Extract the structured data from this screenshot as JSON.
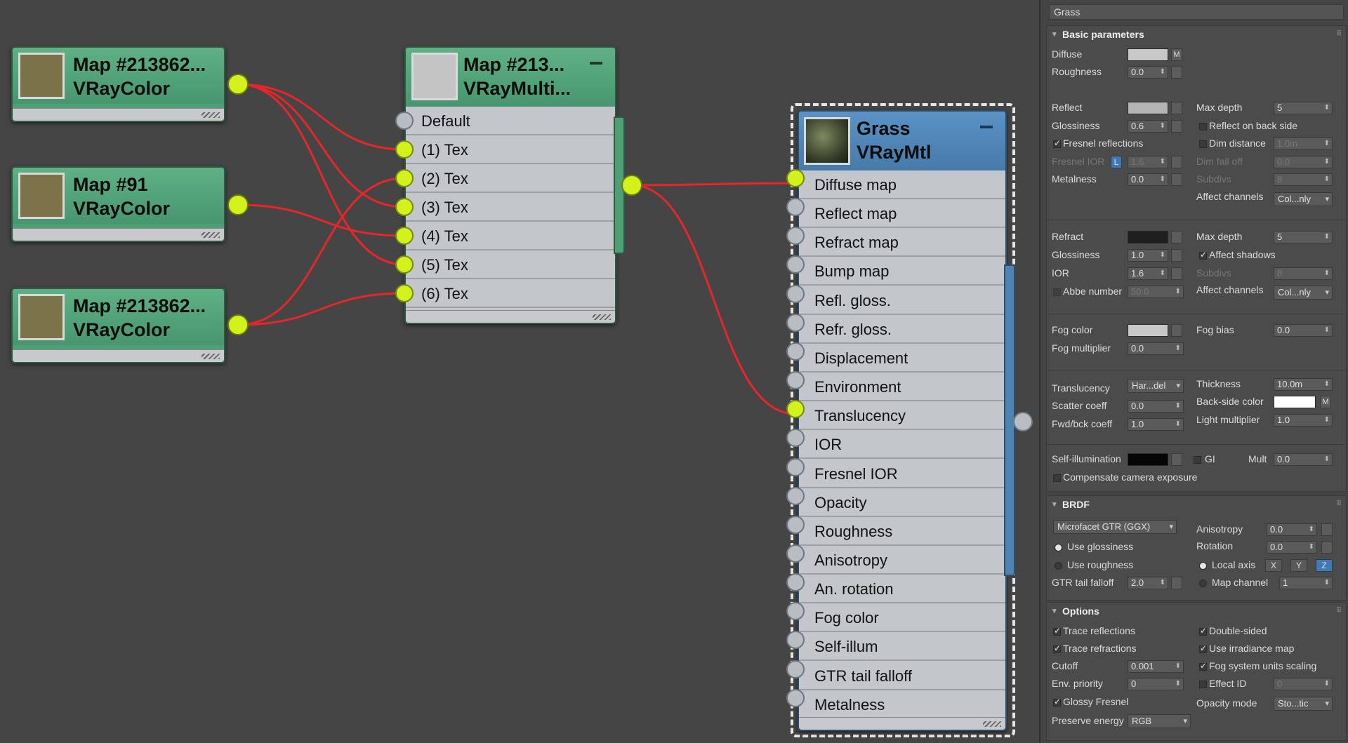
{
  "nodes": {
    "map1": {
      "name": "Map #213862...",
      "type": "VRayColor",
      "thumb_color": "#7b7248"
    },
    "map2": {
      "name": "Map #91",
      "type": "VRayColor",
      "thumb_color": "#7e7348"
    },
    "map3": {
      "name": "Map #213862...",
      "type": "VRayColor",
      "thumb_color": "#7a7448"
    },
    "multi": {
      "name": "Map #213...",
      "type": "VRayMulti...",
      "thumb_color": "#c4c4c4",
      "slots": [
        "Default",
        "(1) Tex",
        "(2) Tex",
        "(3) Tex",
        "(4) Tex",
        "(5) Tex",
        "(6) Tex"
      ]
    },
    "mtl": {
      "name": "Grass",
      "type": "VRayMtl",
      "slots": [
        "Diffuse map",
        "Reflect map",
        "Refract map",
        "Bump map",
        "Refl. gloss.",
        "Refr. gloss.",
        "Displacement",
        "Environment",
        "Translucency",
        "IOR",
        "Fresnel IOR",
        "Opacity",
        "Roughness",
        "Anisotropy",
        "An. rotation",
        "Fog color",
        "Self-illum",
        "GTR tail falloff",
        "Metalness"
      ]
    }
  },
  "colors": {
    "wire": "#e8262a",
    "socket_active": "#d3f11a",
    "green_node": "#4f9f74",
    "blue_node": "#4e83b3"
  },
  "panel": {
    "title": "Grass",
    "basic": {
      "header": "Basic parameters",
      "diffuse": "Diffuse",
      "m": "M",
      "roughness": "Roughness",
      "roughness_val": "0.0",
      "reflect": "Reflect",
      "max_depth": "Max depth",
      "max_depth_val": "5",
      "glossiness": "Glossiness",
      "gloss_val": "0.6",
      "reflect_back": "Reflect on back side",
      "fresnel": "Fresnel reflections",
      "dim_distance": "Dim distance",
      "dim_distance_val": "1.0m",
      "fresnel_ior": "Fresnel IOR",
      "l": "L",
      "fresnel_ior_val": "1.6",
      "dim_falloff": "Dim fall off",
      "dim_falloff_val": "0.0",
      "metalness": "Metalness",
      "metalness_val": "0.0",
      "subdivs": "Subdivs",
      "subdivs_val": "8",
      "affect_channels": "Affect channels",
      "affect_channels_val": "Col...nly",
      "refract": "Refract",
      "refr_max_depth_val": "5",
      "refr_gloss_val": "1.0",
      "affect_shadows": "Affect shadows",
      "ior": "IOR",
      "ior_val": "1.6",
      "refr_subdivs_val": "8",
      "abbe": "Abbe number",
      "abbe_val": "50.0",
      "fog_color": "Fog color",
      "fog_bias": "Fog bias",
      "fog_bias_val": "0.0",
      "fog_mult": "Fog multiplier",
      "fog_mult_val": "0.0",
      "translucency": "Translucency",
      "translucency_val": "Har...del",
      "thickness": "Thickness",
      "thickness_val": "10.0m",
      "scatter": "Scatter coeff",
      "scatter_val": "0.0",
      "backside": "Back-side color",
      "fwd": "Fwd/bck coeff",
      "fwd_val": "1.0",
      "light_mult": "Light multiplier",
      "light_mult_val": "1.0",
      "selfillum": "Self-illumination",
      "gi": "GI",
      "mult": "Mult",
      "mult_val": "0.0",
      "compensate": "Compensate camera exposure"
    },
    "brdf": {
      "header": "BRDF",
      "type": "Microfacet GTR (GGX)",
      "anisotropy": "Anisotropy",
      "anisotropy_val": "0.0",
      "use_gloss": "Use glossiness",
      "rotation": "Rotation",
      "rotation_val": "0.0",
      "use_rough": "Use roughness",
      "local_axis": "Local axis",
      "x": "X",
      "y": "Y",
      "z": "Z",
      "gtr": "GTR tail falloff",
      "gtr_val": "2.0",
      "map_channel": "Map channel",
      "map_channel_val": "1"
    },
    "options": {
      "header": "Options",
      "trace_refl": "Trace reflections",
      "double_sided": "Double-sided",
      "trace_refr": "Trace refractions",
      "use_irr": "Use irradiance map",
      "cutoff": "Cutoff",
      "cutoff_val": "0.001",
      "fog_units": "Fog system units scaling",
      "env_priority": "Env. priority",
      "env_priority_val": "0",
      "effect_id": "Effect ID",
      "effect_id_val": "0",
      "glossy_fresnel": "Glossy Fresnel",
      "opacity_mode": "Opacity mode",
      "opacity_mode_val": "Sto...tic",
      "preserve": "Preserve energy",
      "preserve_val": "RGB"
    }
  }
}
